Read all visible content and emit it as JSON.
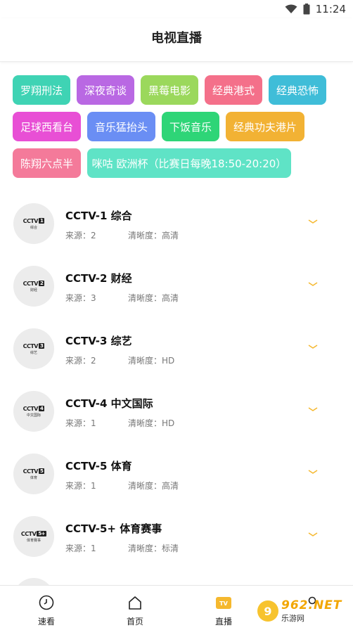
{
  "status_bar": {
    "time": "11:24",
    "wifi_icon": "wifi-icon",
    "battery_icon": "battery-icon"
  },
  "header": {
    "title": "电视直播"
  },
  "tags": [
    {
      "label": "罗翔刑法",
      "color": "#3fd3b4"
    },
    {
      "label": "深夜奇谈",
      "color": "#b968e3"
    },
    {
      "label": "黑莓电影",
      "color": "#9bd85c"
    },
    {
      "label": "经典港式",
      "color": "#f4708a"
    },
    {
      "label": "经典恐怖",
      "color": "#3fbdd8"
    },
    {
      "label": "足球西看台",
      "color": "#e84fd5"
    },
    {
      "label": "音乐猛抬头",
      "color": "#6a8ef4"
    },
    {
      "label": "下饭音乐",
      "color": "#2ed577"
    },
    {
      "label": "经典功夫港片",
      "color": "#f2b234"
    },
    {
      "label": "陈翔六点半",
      "color": "#f47a9a"
    },
    {
      "label": "咪咕 欧洲杯（比赛日每晚18:50-20:20）",
      "color": "#5fe3c6"
    }
  ],
  "channels": [
    {
      "name": "CCTV-1 综合",
      "logo_num": "1",
      "logo_sub": "综合",
      "source": "来源：2",
      "quality": "清晰度：高清"
    },
    {
      "name": "CCTV-2 财经",
      "logo_num": "2",
      "logo_sub": "财经",
      "source": "来源：3",
      "quality": "清晰度：高清"
    },
    {
      "name": "CCTV-3 综艺",
      "logo_num": "3",
      "logo_sub": "综艺",
      "source": "来源：2",
      "quality": "清晰度：HD"
    },
    {
      "name": "CCTV-4 中文国际",
      "logo_num": "4",
      "logo_sub": "中文国际",
      "source": "来源：1",
      "quality": "清晰度：HD"
    },
    {
      "name": "CCTV-5 体育",
      "logo_num": "5",
      "logo_sub": "体育",
      "source": "来源：1",
      "quality": "清晰度：高清"
    },
    {
      "name": "CCTV-5+ 体育赛事",
      "logo_num": "5+",
      "logo_sub": "体育赛事",
      "source": "来源：1",
      "quality": "清晰度：标清"
    }
  ],
  "logo_brand": "CCTV",
  "accent_color": "#f5b82e",
  "bottom_nav": [
    {
      "label": "速看",
      "icon": "clock-icon"
    },
    {
      "label": "首页",
      "icon": "home-icon"
    },
    {
      "label": "直播",
      "icon": "tv-icon",
      "active": true
    },
    {
      "label": "",
      "icon": "profile-icon"
    }
  ],
  "watermark": {
    "circle": "9",
    "top": "962.NET",
    "bottom": "乐游网"
  }
}
